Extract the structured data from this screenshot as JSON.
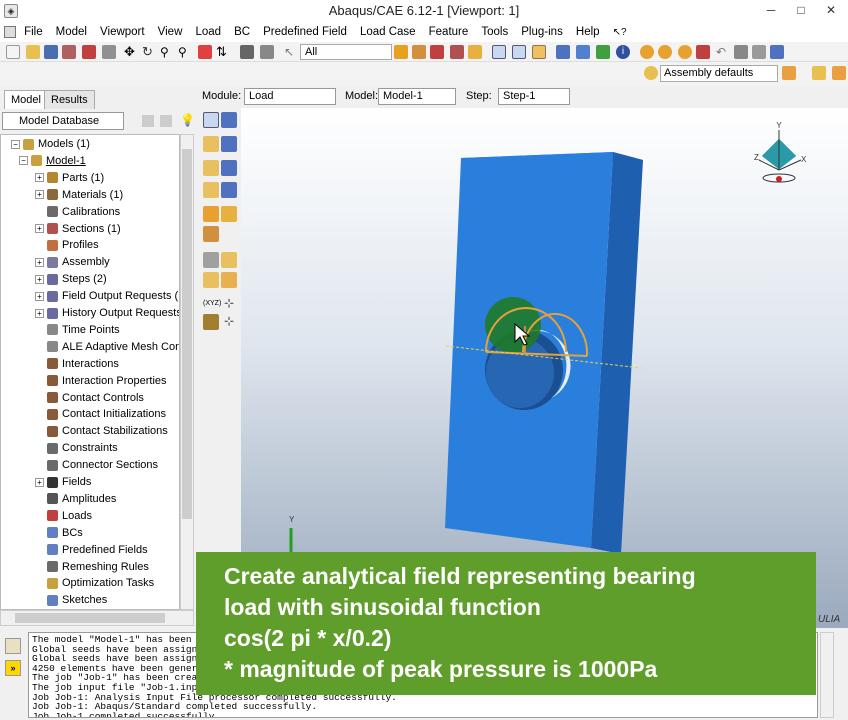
{
  "window": {
    "title": "Abaqus/CAE 6.12-1 [Viewport: 1]",
    "minimize": "─",
    "maximize": "□",
    "close": "✕"
  },
  "menu": [
    "File",
    "Model",
    "Viewport",
    "View",
    "Load",
    "BC",
    "Predefined Field",
    "Load Case",
    "Feature",
    "Tools",
    "Plug-ins",
    "Help"
  ],
  "toolbar": {
    "selection_filter": "All",
    "render_style": "Assembly defaults"
  },
  "tabs": {
    "model": "Model",
    "results": "Results"
  },
  "model_tree": {
    "database": "Model Database",
    "items": [
      {
        "label": "Models (1)",
        "level": 0,
        "expander": "⊟"
      },
      {
        "label": "Model-1",
        "level": 1,
        "expander": "⊟"
      },
      {
        "label": "Parts (1)",
        "level": 2,
        "expander": "⊞"
      },
      {
        "label": "Materials (1)",
        "level": 2,
        "expander": "⊞"
      },
      {
        "label": "Calibrations",
        "level": 2,
        "expander": ""
      },
      {
        "label": "Sections (1)",
        "level": 2,
        "expander": "⊞"
      },
      {
        "label": "Profiles",
        "level": 2,
        "expander": ""
      },
      {
        "label": "Assembly",
        "level": 2,
        "expander": "⊞"
      },
      {
        "label": "Steps (2)",
        "level": 2,
        "expander": "⊞"
      },
      {
        "label": "Field Output Requests (1)",
        "level": 2,
        "expander": "⊞"
      },
      {
        "label": "History Output Requests (",
        "level": 2,
        "expander": "⊞"
      },
      {
        "label": "Time Points",
        "level": 2,
        "expander": ""
      },
      {
        "label": "ALE Adaptive Mesh Const",
        "level": 2,
        "expander": ""
      },
      {
        "label": "Interactions",
        "level": 2,
        "expander": ""
      },
      {
        "label": "Interaction Properties",
        "level": 2,
        "expander": ""
      },
      {
        "label": "Contact Controls",
        "level": 2,
        "expander": ""
      },
      {
        "label": "Contact Initializations",
        "level": 2,
        "expander": ""
      },
      {
        "label": "Contact Stabilizations",
        "level": 2,
        "expander": ""
      },
      {
        "label": "Constraints",
        "level": 2,
        "expander": ""
      },
      {
        "label": "Connector Sections",
        "level": 2,
        "expander": ""
      },
      {
        "label": "Fields",
        "level": 2,
        "expander": "⊞"
      },
      {
        "label": "Amplitudes",
        "level": 2,
        "expander": ""
      },
      {
        "label": "Loads",
        "level": 2,
        "expander": ""
      },
      {
        "label": "BCs",
        "level": 2,
        "expander": ""
      },
      {
        "label": "Predefined Fields",
        "level": 2,
        "expander": ""
      },
      {
        "label": "Remeshing Rules",
        "level": 2,
        "expander": ""
      },
      {
        "label": "Optimization Tasks",
        "level": 2,
        "expander": ""
      },
      {
        "label": "Sketches",
        "level": 2,
        "expander": ""
      }
    ]
  },
  "context": {
    "module_label": "Module:",
    "module": "Load",
    "model_label": "Model:",
    "model": "Model-1",
    "step_label": "Step:",
    "step": "Step-1"
  },
  "viewport": {
    "triad": {
      "x": "X",
      "y": "Y",
      "z": "Z"
    },
    "global_axis": "Y",
    "logo_text": "ULIA"
  },
  "messages": [
    "The model \"Model-1\" has been",
    "Global seeds have been assign",
    "Global seeds have been assign",
    "4250 elements have been gener",
    "The job \"Job-1\" has been crea",
    "The job input file \"Job-1.inp",
    "Job Job-1: Analysis Input File processor completed successfully.",
    "Job Job-1: Abaqus/Standard completed successfully.",
    "Job Job-1 completed successfully."
  ],
  "overlay": {
    "line1": "Create analytical field representing bearing",
    "line2": "load with sinusoidal function",
    "line3": "cos(2 pi * x/0.2)",
    "line4": "* magnitude of peak pressure is 1000Pa"
  },
  "colors": {
    "part": "#2b7fdc",
    "overlay": "#5f9e2a",
    "highlight": "#e5a13a"
  }
}
